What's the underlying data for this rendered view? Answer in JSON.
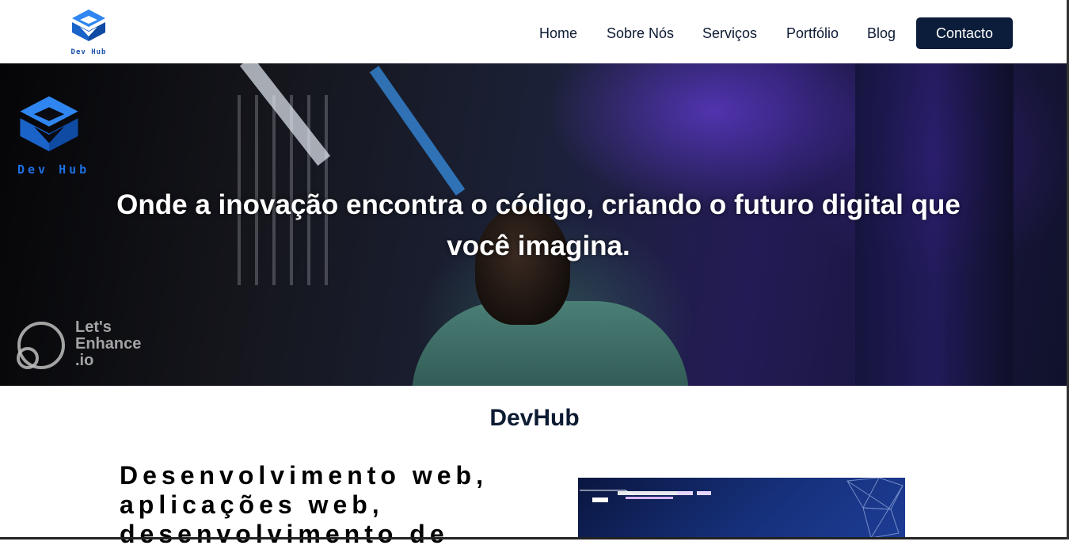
{
  "header": {
    "logo_text": "Dev Hub",
    "nav": [
      "Home",
      "Sobre Nós",
      "Serviços",
      "Portfólio",
      "Blog"
    ],
    "contact_label": "Contacto"
  },
  "hero": {
    "logo_text": "Dev Hub",
    "heading_line1": "Onde a inovação encontra o código, criando o futuro digital que",
    "heading_line2": "você imagina.",
    "watermark_lines": [
      "Let's",
      "Enhance",
      ".io"
    ]
  },
  "about": {
    "title": "DevHub",
    "services_lines": [
      "Desenvolvimento web,",
      "aplicações web,",
      "desenvolvimento de"
    ]
  },
  "colors": {
    "brand_navy": "#0b1d3a",
    "logo_blue": "#1e6fe0"
  },
  "icons": {
    "logo": "dev-hub-cube-logo",
    "watermark": "lets-enhance-logo"
  }
}
